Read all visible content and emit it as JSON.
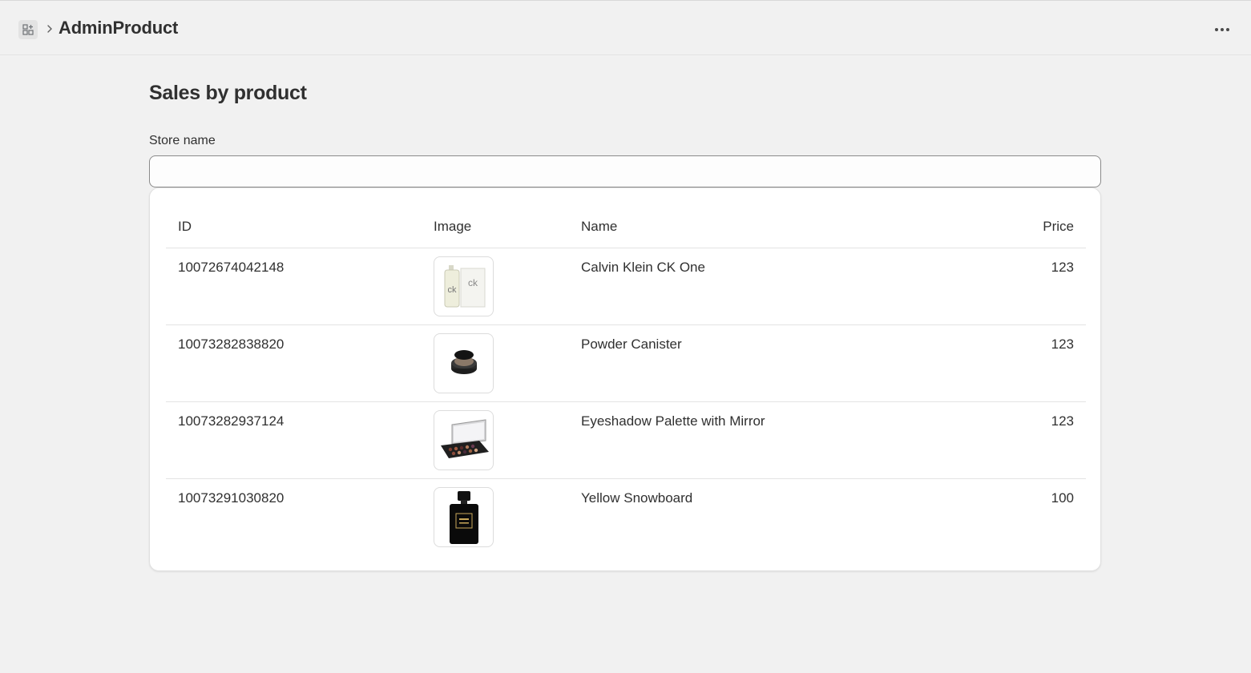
{
  "header": {
    "app_icon": "apps-grid-icon",
    "breadcrumb_separator_icon": "chevron-right-icon",
    "title": "AdminProduct",
    "more_icon": "more-horizontal-icon"
  },
  "page": {
    "title": "Sales by product"
  },
  "filter": {
    "label": "Store name",
    "value": "",
    "placeholder": ""
  },
  "table": {
    "columns": [
      "ID",
      "Image",
      "Name",
      "Price"
    ],
    "rows": [
      {
        "id": "10072674042148",
        "image": "ck-one-perfume-image",
        "name": "Calvin Klein CK One",
        "price": "123"
      },
      {
        "id": "10073282838820",
        "image": "powder-canister-image",
        "name": "Powder Canister",
        "price": "123"
      },
      {
        "id": "10073282937124",
        "image": "eyeshadow-palette-image",
        "name": "Eyeshadow Palette with Mirror",
        "price": "123"
      },
      {
        "id": "10073291030820",
        "image": "black-perfume-bottle-image",
        "name": "Yellow Snowboard",
        "price": "100"
      }
    ]
  }
}
